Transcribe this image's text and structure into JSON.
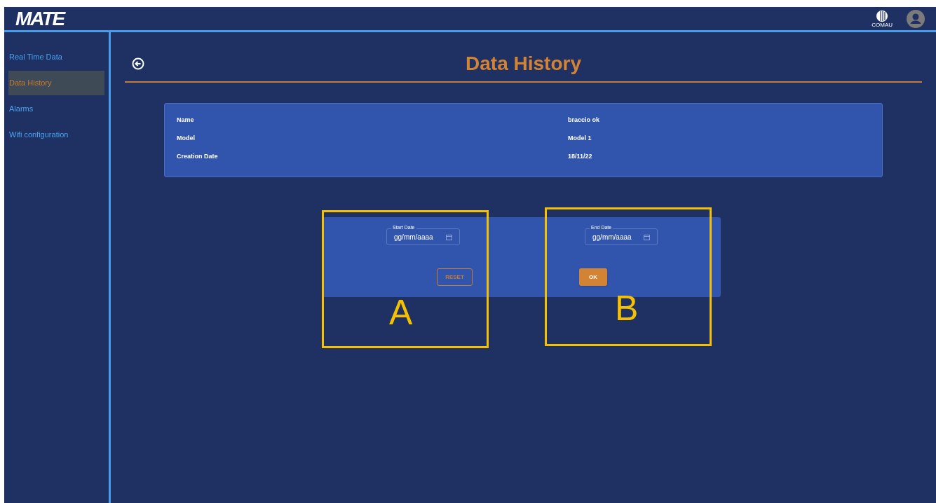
{
  "header": {
    "logo": "MATE",
    "brand_mark": "COMAU"
  },
  "sidebar": {
    "items": [
      {
        "label": "Real Time Data",
        "selected": false
      },
      {
        "label": "Data History",
        "selected": true
      },
      {
        "label": "Alarms",
        "selected": false
      },
      {
        "label": "Wifi configuration",
        "selected": false
      }
    ]
  },
  "page": {
    "title": "Data History"
  },
  "info": {
    "rows": [
      {
        "label": "Name",
        "value": "braccio ok"
      },
      {
        "label": "Model",
        "value": "Model 1"
      },
      {
        "label": "Creation Date",
        "value": "18/11/22"
      }
    ]
  },
  "date_filter": {
    "start": {
      "label": "Start Date",
      "placeholder": "gg/mm/aaaa"
    },
    "end": {
      "label": "End Date",
      "placeholder": "gg/mm/aaaa"
    },
    "reset_button": "RESET",
    "ok_button": "OK"
  },
  "annotations": [
    {
      "label": "A"
    },
    {
      "label": "B"
    }
  ]
}
